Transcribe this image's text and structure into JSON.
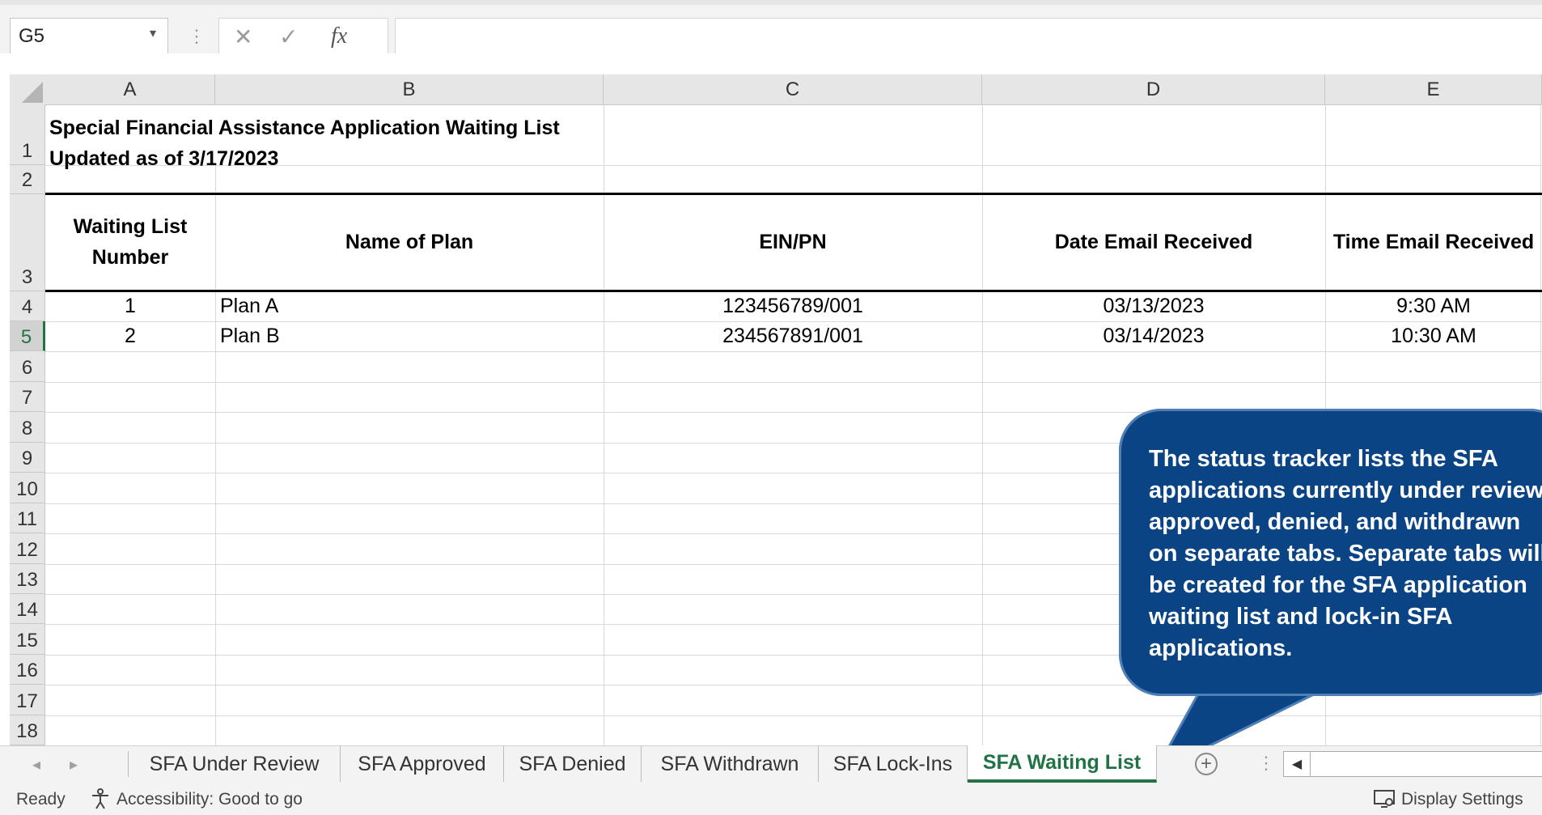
{
  "formula_bar": {
    "name_box": "G5",
    "cancel_icon": "✕",
    "enter_icon": "✓",
    "fx_label": "fx",
    "formula": ""
  },
  "columns": [
    "A",
    "B",
    "C",
    "D",
    "E"
  ],
  "rows": [
    "1",
    "2",
    "3",
    "4",
    "5",
    "6",
    "7",
    "8",
    "9",
    "10",
    "11",
    "12",
    "13",
    "14",
    "15",
    "16",
    "17",
    "18"
  ],
  "active_row": "5",
  "sheet": {
    "title_line1": "Special Financial Assistance Application Waiting List",
    "title_line2": "Updated as of 3/17/2023",
    "headers": {
      "waiting_list_number_line1": "Waiting List",
      "waiting_list_number_line2": "Number",
      "name_of_plan": "Name of Plan",
      "ein_pn": "EIN/PN",
      "date_email_received": "Date Email Received",
      "time_email_received": "Time Email Received"
    },
    "data_rows": [
      {
        "number": "1",
        "plan": "Plan A",
        "ein_pn": "123456789/001",
        "date": "03/13/2023",
        "time": "9:30 AM"
      },
      {
        "number": "2",
        "plan": "Plan B",
        "ein_pn": "234567891/001",
        "date": "03/14/2023",
        "time": "10:30 AM"
      }
    ]
  },
  "callout": {
    "text": "The status tracker lists the SFA applications currently under review, approved, denied, and withdrawn on separate tabs. Separate tabs will be created for the SFA application waiting list and lock-in SFA applications."
  },
  "tabs": [
    "SFA Under Review",
    "SFA Approved",
    "SFA Denied",
    "SFA Withdrawn",
    "SFA Lock-Ins",
    "SFA Waiting List"
  ],
  "active_tab": "SFA Waiting List",
  "status_bar": {
    "ready": "Ready",
    "accessibility": "Accessibility: Good to go",
    "display_settings": "Display Settings"
  },
  "colors": {
    "excel_green": "#217346",
    "callout_blue": "#0b4485"
  },
  "icons": {
    "cancel": "close-icon",
    "enter": "checkmark-icon",
    "function": "fx-icon",
    "add_sheet": "plus-circle-icon",
    "accessibility": "accessibility-icon",
    "display_settings": "display-settings-icon"
  }
}
